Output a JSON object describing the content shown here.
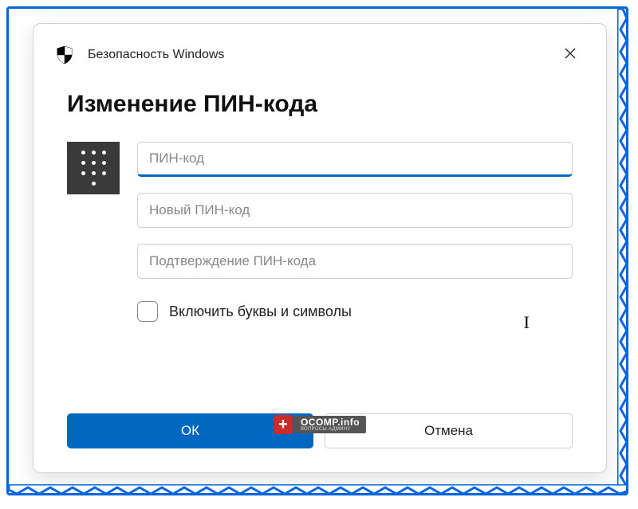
{
  "titlebar": {
    "app_name": "Безопасность Windows"
  },
  "dialog": {
    "heading": "Изменение ПИН-кода"
  },
  "fields": {
    "current_pin_placeholder": "ПИН-код",
    "new_pin_placeholder": "Новый ПИН-код",
    "confirm_pin_placeholder": "Подтверждение ПИН-кода"
  },
  "checkbox": {
    "label": "Включить буквы и символы"
  },
  "buttons": {
    "ok": "ОК",
    "cancel": "Отмена"
  },
  "watermark": {
    "line1": "OCOMP.info",
    "line2": "ВОПРОСЫ АДМИНУ"
  },
  "colors": {
    "accent": "#0067c0",
    "frame": "#0066dd"
  }
}
